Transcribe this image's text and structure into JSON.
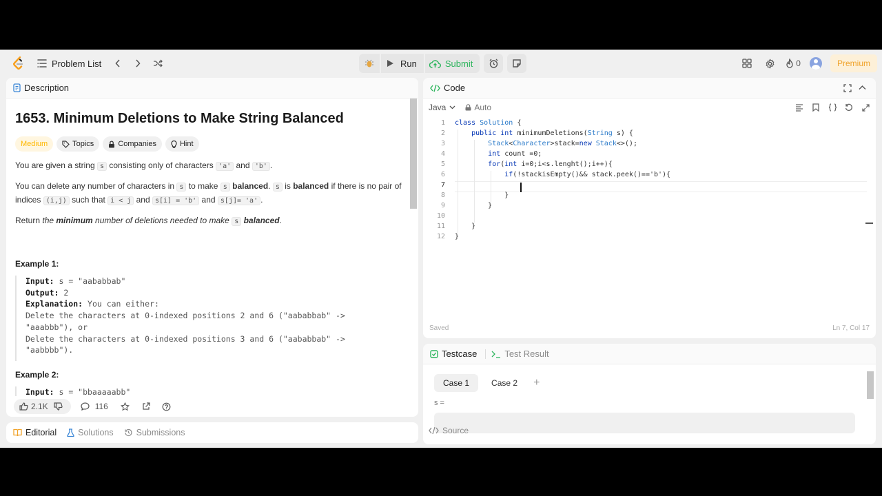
{
  "nav": {
    "problem_list": "Problem List",
    "run": "Run",
    "submit": "Submit",
    "streak": "0",
    "premium": "Premium"
  },
  "description": {
    "tab": "Description",
    "title": "1653. Minimum Deletions to Make String Balanced",
    "difficulty": "Medium",
    "tags": [
      "Topics",
      "Companies",
      "Hint"
    ],
    "p1": [
      "You are given a string ",
      "s",
      " consisting only of characters ",
      "'a'",
      " and ",
      "'b'",
      "."
    ],
    "p2": [
      "You can delete any number of characters in ",
      "s",
      " to make ",
      "s",
      " ",
      "balanced",
      ". ",
      "s",
      " is ",
      "balanced",
      " if there is no pair of indices ",
      "(i,j)",
      " such that ",
      "i < j",
      " and ",
      "s[i] = 'b'",
      " and ",
      "s[j]= 'a'",
      "."
    ],
    "p3": [
      "Return ",
      "the ",
      "minimum",
      " number of deletions needed to make ",
      "s",
      " ",
      "balanced",
      "."
    ],
    "example1": {
      "heading": "Example 1:",
      "input_label": "Input:",
      "input": " s = \"aababbab\"",
      "output_label": "Output:",
      "output": " 2",
      "explanation_label": "Explanation:",
      "explanation": " You can either:",
      "line1": "Delete the characters at 0-indexed positions 2 and 6 (\"aababbab\" ->",
      "line2": "\"aaabbb\"), or",
      "line3": "Delete the characters at 0-indexed positions 3 and 6 (\"aababbab\" ->",
      "line4": "\"aabbbb\")."
    },
    "example2": {
      "heading": "Example 2:",
      "input_label": "Input:",
      "input": " s = \"bbaaaaabb\""
    },
    "likes": "2.1K",
    "comments": "116"
  },
  "bottom_tabs": [
    "Editorial",
    "Solutions",
    "Submissions"
  ],
  "code": {
    "tab": "Code",
    "language": "Java",
    "mode": "Auto",
    "lines": [
      "class Solution {",
      "    public int minimumDeletions(String s) {",
      "        Stack<Character>stack=new Stack<>();",
      "        int count =0;",
      "        for(int i=0;i<s.lenght();i++){",
      "            if(!stackisEmpty()&& stack.peek()=='b'){",
      "                ",
      "            }",
      "        }",
      "",
      "    }",
      "}"
    ],
    "line_numbers": [
      "1",
      "2",
      "3",
      "4",
      "5",
      "6",
      "7",
      "8",
      "9",
      "10",
      "11",
      "12"
    ],
    "saved": "Saved",
    "position": "Ln 7, Col 17"
  },
  "testcase": {
    "tab": "Testcase",
    "result_tab": "Test Result",
    "cases": [
      "Case 1",
      "Case 2"
    ],
    "var": "s =",
    "source": "Source"
  }
}
